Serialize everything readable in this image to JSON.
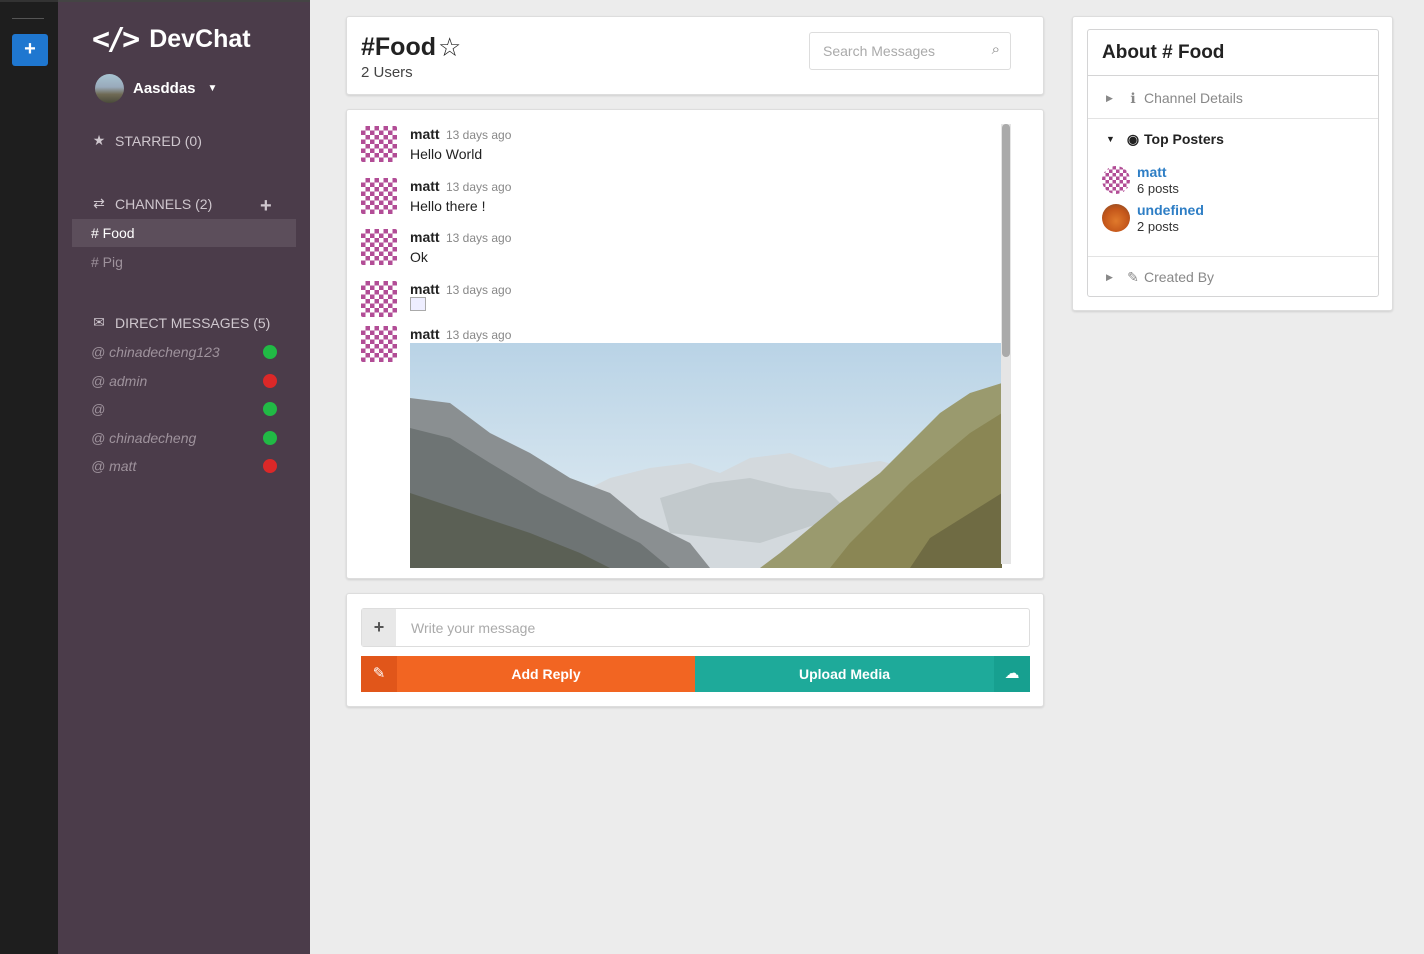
{
  "color_panel": {
    "add_label": "+"
  },
  "sidebar": {
    "app_title": "DevChat",
    "logo_glyph": "</>",
    "user": {
      "name": "Aasddas"
    },
    "starred": {
      "label": "STARRED (0)"
    },
    "channels": {
      "label": "CHANNELS (2)",
      "add_label": "+",
      "items": [
        {
          "label": "# Food",
          "active": true
        },
        {
          "label": "# Pig",
          "active": false
        }
      ]
    },
    "direct_messages": {
      "label": "DIRECT MESSAGES (5)",
      "items": [
        {
          "label": "@ chinadecheng123",
          "status": "online"
        },
        {
          "label": "@ admin",
          "status": "offline"
        },
        {
          "label": "@",
          "status": "online"
        },
        {
          "label": "@ chinadecheng",
          "status": "online"
        },
        {
          "label": "@ matt",
          "status": "offline"
        }
      ]
    }
  },
  "header": {
    "channel_name": "#Food",
    "users": "2 Users",
    "search_placeholder": "Search Messages"
  },
  "messages": [
    {
      "author": "matt",
      "time": "13 days ago",
      "text": "Hello World"
    },
    {
      "author": "matt",
      "time": "13 days ago",
      "text": "Hello there !"
    },
    {
      "author": "matt",
      "time": "13 days ago",
      "text": "Ok"
    },
    {
      "author": "matt",
      "time": "13 days ago",
      "image": "broken"
    },
    {
      "author": "matt",
      "time": "13 days ago",
      "image": "mountain-landscape"
    }
  ],
  "form": {
    "message_placeholder": "Write your message",
    "reply_label": "Add Reply",
    "upload_label": "Upload Media"
  },
  "meta": {
    "title": "About # Food",
    "channel_details": "Channel Details",
    "top_posters": "Top Posters",
    "created_by": "Created By",
    "posters": [
      {
        "name": "matt",
        "count": "6 posts"
      },
      {
        "name": "undefined",
        "count": "2 posts"
      }
    ]
  },
  "colors": {
    "sidebar_bg": "#4b3c4a",
    "reply_button": "#f26522",
    "upload_button": "#1eaa9a",
    "link": "#2e7ec5",
    "online": "#21ba45",
    "offline": "#db2828"
  }
}
